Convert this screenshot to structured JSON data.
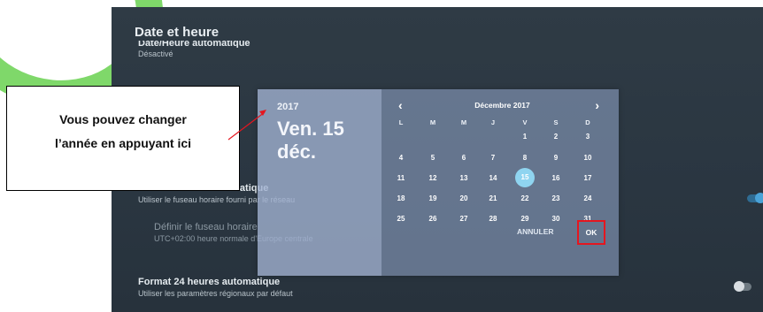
{
  "screen": {
    "title": "Date et heure"
  },
  "settings": {
    "auto_date": {
      "title": "Date/Heure automatique",
      "subtitle": "Désactivé"
    },
    "auto_timezone": {
      "title": "Fuseau horaire automatique",
      "subtitle": "Utiliser le fuseau horaire fourni par le réseau"
    },
    "set_timezone": {
      "title": "Définir le fuseau horaire",
      "subtitle": "UTC+02:00 heure normale d'Europe centrale"
    },
    "format24": {
      "title": "Format 24 heures automatique",
      "subtitle": "Utiliser les paramètres régionaux par défaut"
    }
  },
  "dialog": {
    "year": "2017",
    "date_line1": "Ven. 15",
    "date_line2": "déc.",
    "month_label": "Décembre 2017",
    "prev": "‹",
    "next": "›",
    "weekdays": [
      "L",
      "M",
      "M",
      "J",
      "V",
      "S",
      "D"
    ],
    "weeks": [
      [
        "",
        "",
        "",
        "",
        "1",
        "2",
        "3"
      ],
      [
        "4",
        "5",
        "6",
        "7",
        "8",
        "9",
        "10"
      ],
      [
        "11",
        "12",
        "13",
        "14",
        "15",
        "16",
        "17"
      ],
      [
        "18",
        "19",
        "20",
        "21",
        "22",
        "23",
        "24"
      ],
      [
        "25",
        "26",
        "27",
        "28",
        "29",
        "30",
        "31"
      ]
    ],
    "selected_day": "15",
    "cancel_label": "ANNULER",
    "ok_label": "OK"
  },
  "annotation": {
    "text": "Vous pouvez changer\nl’année en appuyant  ici"
  },
  "colors": {
    "highlight_border": "#e5161f",
    "toggle_on": "#4aa3d8",
    "selected_day": "#8fd4f0",
    "green_arc": "#7fd86a"
  }
}
